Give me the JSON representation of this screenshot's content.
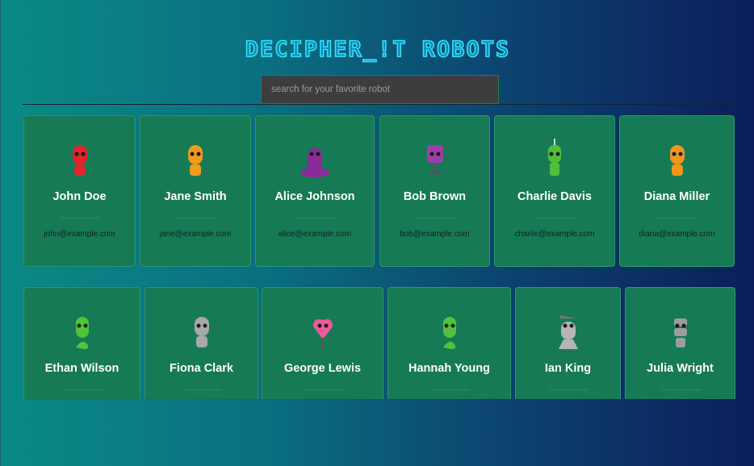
{
  "header": {
    "title": "DECIPHER_!T ROBOTS"
  },
  "search": {
    "placeholder": "search for your favorite robot",
    "value": ""
  },
  "robots": [
    {
      "name": "John Doe",
      "email": "john@example.com",
      "color": "#e0252b",
      "icon": "robot-avatar"
    },
    {
      "name": "Jane Smith",
      "email": "jane@example.com",
      "color": "#f09a1e",
      "icon": "robot-avatar"
    },
    {
      "name": "Alice Johnson",
      "email": "alice@example.com",
      "color": "#8b2a9a",
      "icon": "robot-avatar"
    },
    {
      "name": "Bob Brown",
      "email": "bob@example.com",
      "color": "#9b3fa8",
      "icon": "robot-avatar"
    },
    {
      "name": "Charlie Davis",
      "email": "charlie@example.com",
      "color": "#4fbf3a",
      "icon": "robot-avatar"
    },
    {
      "name": "Diana Miller",
      "email": "diana@example.com",
      "color": "#f0961a",
      "icon": "robot-avatar"
    },
    {
      "name": "Ethan Wilson",
      "email": "",
      "color": "#4fc43a",
      "icon": "robot-avatar"
    },
    {
      "name": "Fiona Clark",
      "email": "",
      "color": "#a8a8a8",
      "icon": "robot-avatar"
    },
    {
      "name": "George Lewis",
      "email": "",
      "color": "#ec5a9a",
      "icon": "robot-avatar"
    },
    {
      "name": "Hannah Young",
      "email": "",
      "color": "#52c23c",
      "icon": "robot-avatar"
    },
    {
      "name": "Ian King",
      "email": "",
      "color": "#b5b5b5",
      "icon": "robot-avatar"
    },
    {
      "name": "Julia Wright",
      "email": "",
      "color": "#9d9d9d",
      "icon": "robot-avatar"
    }
  ]
}
